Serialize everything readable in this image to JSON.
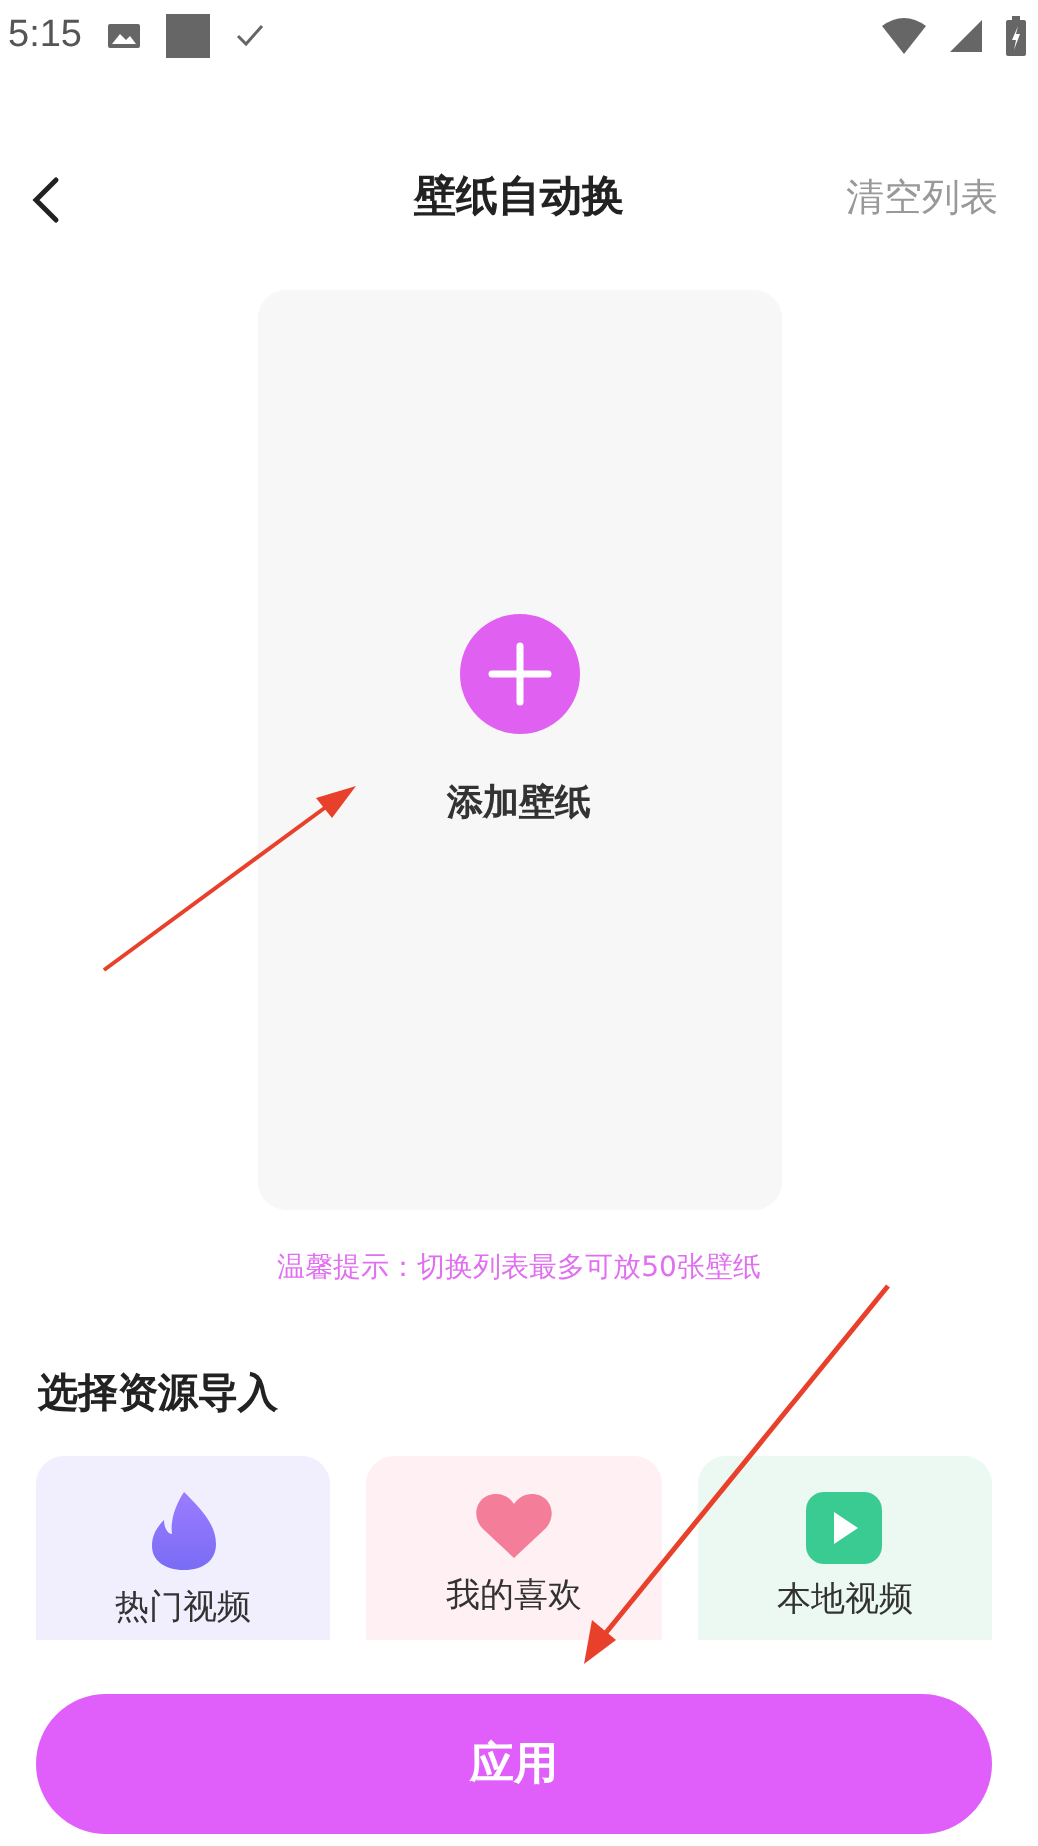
{
  "status_bar": {
    "time": "5:15"
  },
  "header": {
    "title": "壁纸自动换",
    "action": "清空列表"
  },
  "preview": {
    "add_label": "添加壁纸"
  },
  "tip": "温馨提示：切换列表最多可放50张壁纸",
  "sources": {
    "title": "选择资源导入",
    "items": [
      {
        "kind": "hot",
        "label": "热门视频"
      },
      {
        "kind": "liked",
        "label": "我的喜欢"
      },
      {
        "kind": "local",
        "label": "本地视频"
      }
    ]
  },
  "apply_button": "应用"
}
